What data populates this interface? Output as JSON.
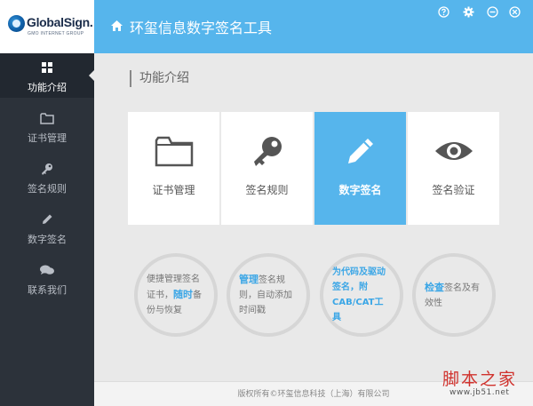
{
  "logo": {
    "brand": "GlobalSign.",
    "sub": "GMO INTERNET GROUP"
  },
  "header": {
    "title": "环玺信息数字签名工具"
  },
  "sidebar": {
    "items": [
      {
        "label": "功能介绍",
        "icon": "grid-icon",
        "active": true
      },
      {
        "label": "证书管理",
        "icon": "folder-icon",
        "active": false
      },
      {
        "label": "签名规则",
        "icon": "key-icon",
        "active": false
      },
      {
        "label": "数字签名",
        "icon": "pencil-icon",
        "active": false
      },
      {
        "label": "联系我们",
        "icon": "chat-icon",
        "active": false
      }
    ]
  },
  "main": {
    "section_title": "功能介绍",
    "cards": [
      {
        "label": "证书管理",
        "icon": "folder-icon",
        "active": false
      },
      {
        "label": "签名规则",
        "icon": "key-icon",
        "active": false
      },
      {
        "label": "数字签名",
        "icon": "pencil-icon",
        "active": true
      },
      {
        "label": "签名验证",
        "icon": "eye-icon",
        "active": false
      }
    ],
    "bubbles": [
      {
        "pre": "便捷管理签名证书，",
        "highlight": "随时",
        "post": "备份与恢复"
      },
      {
        "pre": "",
        "highlight": "管理",
        "post": "签名规则，自动添加时间戳"
      },
      {
        "text": "为代码及驱动签名，附CAB/CAT工具"
      },
      {
        "pre": "",
        "highlight": "检查",
        "post": "签名及有效性"
      }
    ]
  },
  "footer": {
    "text": "版权所有©环玺信息科技（上海）有限公司"
  },
  "watermark": {
    "text": "脚本之家",
    "url": "www.jb51.net"
  },
  "colors": {
    "accent": "#56b5ec",
    "sidebar": "#2c323a",
    "highlight": "#3ba6e6"
  }
}
